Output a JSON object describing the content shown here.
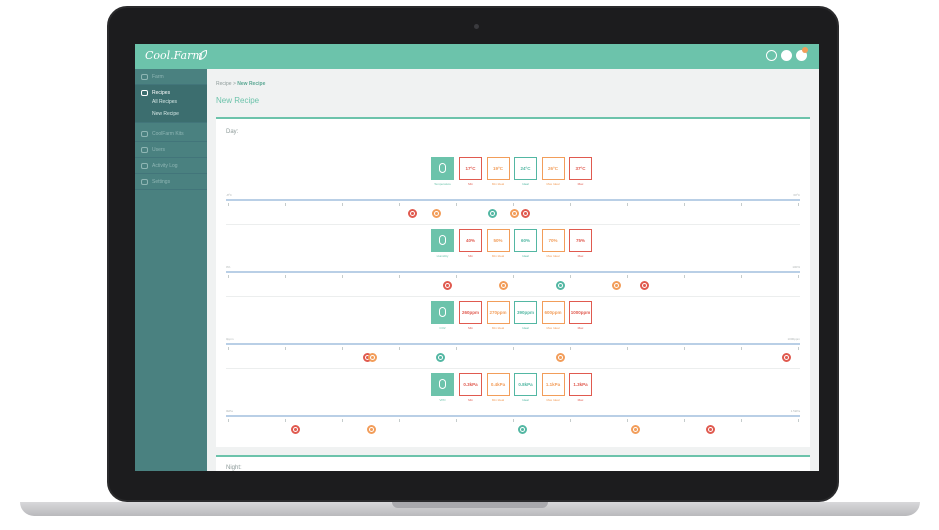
{
  "app": {
    "logo_text": "Cool.Farm"
  },
  "colors": {
    "accent": "#6cc3ab",
    "sidebar": "#4a8180",
    "min": "#e05a4f",
    "minIdeal": "#f29d5a",
    "ideal": "#53b7a3"
  },
  "sidebar": {
    "items": [
      {
        "label": "Farm",
        "icon": "leaf-icon"
      },
      {
        "label": "Recipes",
        "icon": "bowl-icon"
      },
      {
        "label": "CoolFarm Kits",
        "icon": "kit-icon"
      },
      {
        "label": "Users",
        "icon": "users-icon"
      },
      {
        "label": "Activity Log",
        "icon": "list-icon"
      },
      {
        "label": "Settings",
        "icon": "gear-icon"
      }
    ],
    "sub_items": [
      "All Recipes",
      "New Recipe"
    ]
  },
  "breadcrumb": {
    "root": "Recipe",
    "separator": ">",
    "current": "New Recipe"
  },
  "page_title": "New Recipe",
  "day": {
    "label": "Day:",
    "rows": [
      {
        "name": "Temperature",
        "icon": "thermometer-icon",
        "values": [
          "17ºC",
          "19ºC",
          "24ºC",
          "26ºC",
          "37ºC"
        ],
        "labels": [
          "Min",
          "Min Ideal",
          "Ideal",
          "Max Ideal",
          "Max"
        ],
        "axis_min": "-8ºC",
        "axis_max": "60ºC"
      },
      {
        "name": "Humidity",
        "icon": "drop-icon",
        "values": [
          "40%",
          "50%",
          "60%",
          "70%",
          "75%"
        ],
        "labels": [
          "Min",
          "Min Ideal",
          "Ideal",
          "Max Ideal",
          "Max"
        ],
        "axis_min": "0%",
        "axis_max": "100%"
      },
      {
        "name": "CO2",
        "icon": "cloud-icon",
        "values": [
          "260ppm",
          "270ppm",
          "390ppm",
          "600ppm",
          "1000ppm"
        ],
        "labels": [
          "Min",
          "Min Ideal",
          "Ideal",
          "Max Ideal",
          "Max"
        ],
        "axis_min": "0ppm",
        "axis_max": "1000ppm"
      },
      {
        "name": "VPD",
        "icon": "gauge-icon",
        "values": [
          "0.3kPa",
          "0.4kPa",
          "0.8kPa",
          "1.1kPa",
          "1.3kPa"
        ],
        "labels": [
          "Min",
          "Min Ideal",
          "Ideal",
          "Max Ideal",
          "Max"
        ],
        "axis_min": "0kPa",
        "axis_max": "1.5kPa"
      }
    ]
  },
  "night": {
    "label": "Night:"
  }
}
